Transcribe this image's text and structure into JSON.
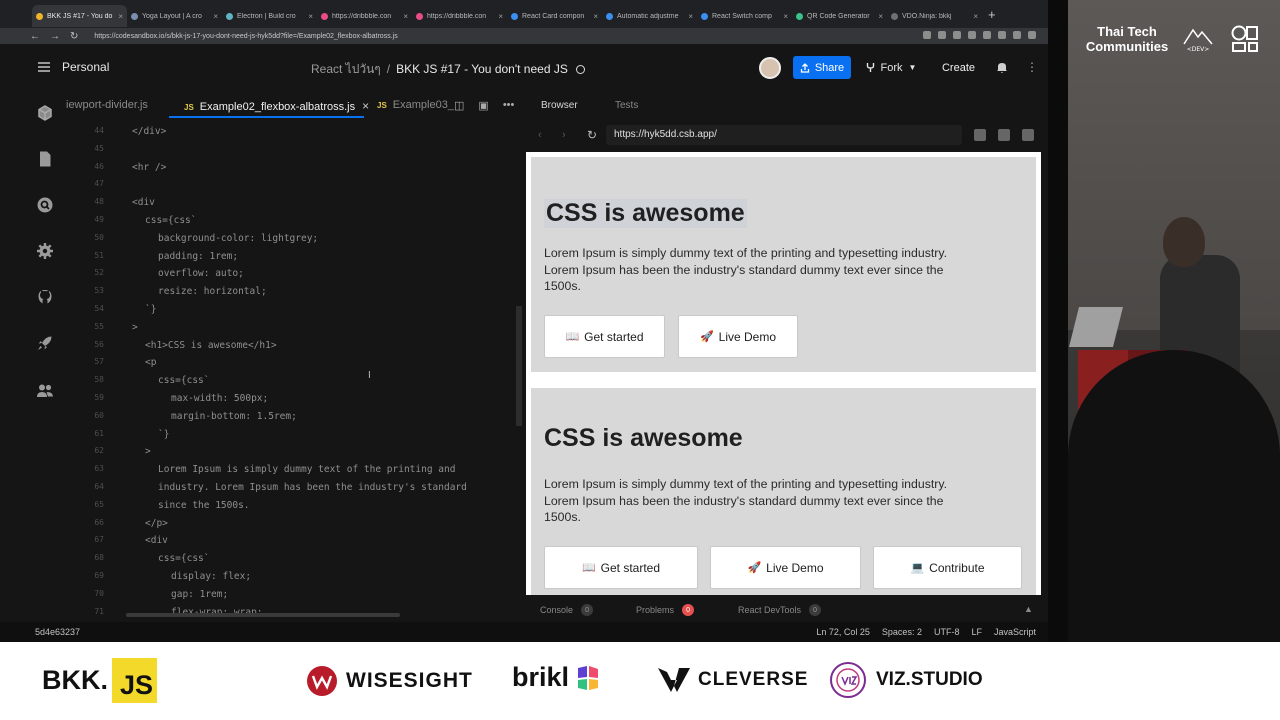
{
  "browser": {
    "tabs": [
      {
        "title": "BKK JS #17 - You do",
        "color": "#f0b429",
        "active": true
      },
      {
        "title": "Yoga Layout | A cro",
        "color": "#7a8fb0"
      },
      {
        "title": "Electron | Build cro",
        "color": "#5fb3c3"
      },
      {
        "title": "https://dribbble.con",
        "color": "#ea4c89"
      },
      {
        "title": "https://dribbble.con",
        "color": "#ea4c89"
      },
      {
        "title": "React Card compon",
        "color": "#3a8ff0"
      },
      {
        "title": "Automatic adjustme",
        "color": "#3a8ff0"
      },
      {
        "title": "React Switch comp",
        "color": "#3a8ff0"
      },
      {
        "title": "QR Code Generator",
        "color": "#3ac28a"
      },
      {
        "title": "VDO.Ninja: bkkj",
        "color": "#6f6f6f"
      }
    ],
    "url": "https://codesandbox.io/s/bkk-js-17-you-dont-need-js-hyk5dd?file=/Example02_flexbox-albatross.js"
  },
  "header": {
    "workspace": "Personal",
    "folder": "React ไปวันๆ",
    "separator": "/",
    "project": "BKK JS #17 - You don't need JS",
    "share": "Share",
    "fork": "Fork",
    "create": "Create"
  },
  "editor": {
    "tabs": [
      "iewport-divider.js",
      "Example02_flexbox-albatross.js",
      "Example03_"
    ],
    "js_badge": "JS",
    "lines": [
      {
        "n": "44",
        "indent": 2,
        "text": "</div>"
      },
      {
        "n": "45",
        "indent": 0,
        "text": ""
      },
      {
        "n": "46",
        "indent": 2,
        "text": "<hr />"
      },
      {
        "n": "47",
        "indent": 0,
        "text": ""
      },
      {
        "n": "48",
        "indent": 2,
        "text": "<div"
      },
      {
        "n": "49",
        "indent": 3,
        "text": "css={css`"
      },
      {
        "n": "50",
        "indent": 4,
        "text": "background-color: lightgrey;"
      },
      {
        "n": "51",
        "indent": 4,
        "text": "padding: 1rem;"
      },
      {
        "n": "52",
        "indent": 4,
        "text": "overflow: auto;"
      },
      {
        "n": "53",
        "indent": 4,
        "text": "resize: horizontal;"
      },
      {
        "n": "54",
        "indent": 3,
        "text": "`}"
      },
      {
        "n": "55",
        "indent": 2,
        "text": ">"
      },
      {
        "n": "56",
        "indent": 3,
        "text": "<h1>CSS is awesome</h1>"
      },
      {
        "n": "57",
        "indent": 3,
        "text": "<p"
      },
      {
        "n": "58",
        "indent": 4,
        "text": "css={css`"
      },
      {
        "n": "59",
        "indent": 5,
        "text": "max-width: 500px;"
      },
      {
        "n": "60",
        "indent": 5,
        "text": "margin-bottom: 1.5rem;"
      },
      {
        "n": "61",
        "indent": 4,
        "text": "`}"
      },
      {
        "n": "62",
        "indent": 3,
        "text": ">"
      },
      {
        "n": "63",
        "indent": 4,
        "text": "Lorem Ipsum is simply dummy text of the printing and"
      },
      {
        "n": "64",
        "indent": 4,
        "text": "industry. Lorem Ipsum has been the industry's standard"
      },
      {
        "n": "65",
        "indent": 4,
        "text": "since the 1500s."
      },
      {
        "n": "66",
        "indent": 3,
        "text": "</p>"
      },
      {
        "n": "67",
        "indent": 3,
        "text": "<div"
      },
      {
        "n": "68",
        "indent": 4,
        "text": "css={css`"
      },
      {
        "n": "69",
        "indent": 5,
        "text": "display: flex;"
      },
      {
        "n": "70",
        "indent": 5,
        "text": "gap: 1rem;"
      },
      {
        "n": "71",
        "indent": 5,
        "text": "flex-wrap: wrap;"
      }
    ]
  },
  "preview": {
    "tab_browser": "Browser",
    "tab_tests": "Tests",
    "url": "https://hyk5dd.csb.app/",
    "demo1": {
      "heading": "CSS is awesome",
      "paragraph": "Lorem Ipsum is simply dummy text of the printing and typesetting industry. Lorem Ipsum has been the industry's standard dummy text ever since the 1500s.",
      "btn_start": "Get started",
      "btn_demo": "Live Demo"
    },
    "demo2": {
      "heading": "CSS is awesome",
      "paragraph": "Lorem Ipsum is simply dummy text of the printing and typesetting industry. Lorem Ipsum has been the industry's standard dummy text ever since the 1500s.",
      "btn_start": "Get started",
      "btn_demo": "Live Demo",
      "btn_contribute": "Contribute"
    },
    "icons": {
      "book": "📖",
      "rocket": "🚀",
      "computer": "💻"
    }
  },
  "console_bar": {
    "console": "Console",
    "console_count": "0",
    "problems": "Problems",
    "problems_count": "0",
    "devtools": "React DevTools",
    "devtools_count": "0"
  },
  "statusbar": {
    "commit": "5d4e63237",
    "position": "Ln 72, Col 25",
    "spaces": "Spaces: 2",
    "encoding": "UTF-8",
    "eol": "LF",
    "language": "JavaScript"
  },
  "stage": {
    "community": "Thai Tech Communities",
    "dev_badge": "<DEV>"
  },
  "sponsors": {
    "bkk_prefix": "BKK.",
    "bkk_js": "JS",
    "wisesight": "WISESIGHT",
    "brikl": "brikl",
    "cleverse": "CLEVERSE",
    "viz": "VIZ.STUDIO"
  }
}
